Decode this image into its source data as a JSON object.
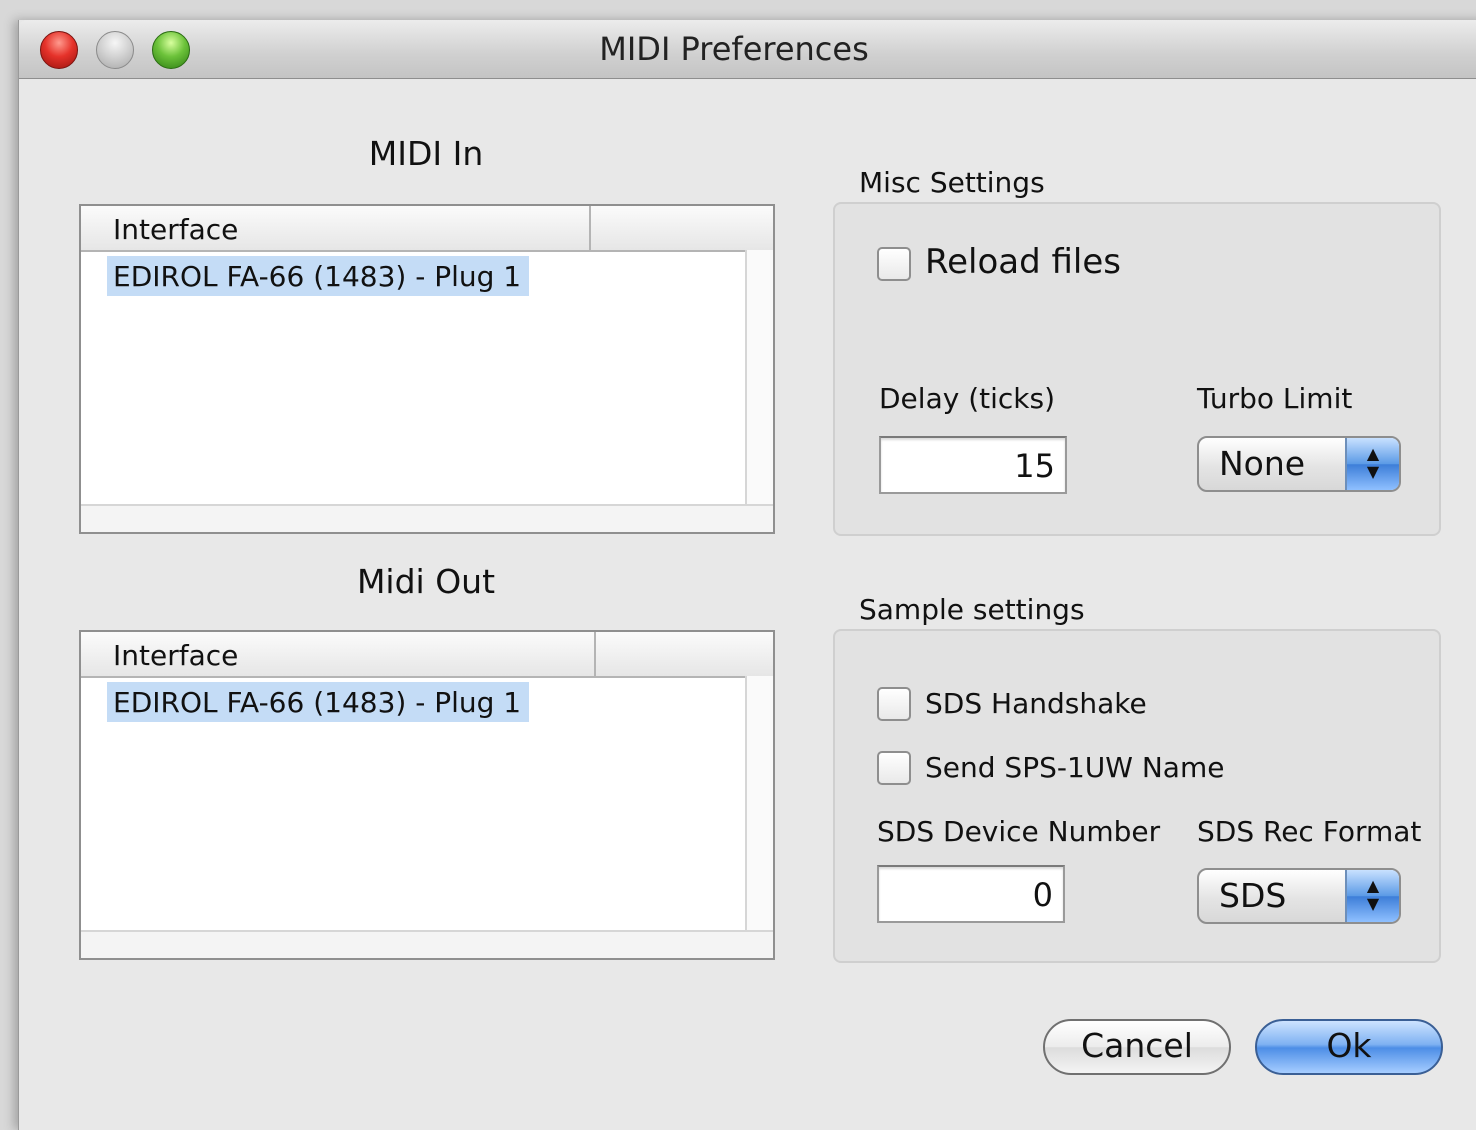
{
  "window": {
    "title": "MIDI Preferences"
  },
  "midi_in": {
    "heading": "MIDI In",
    "column_header": "Interface",
    "items": [
      "EDIROL FA-66 (1483) - Plug 1"
    ]
  },
  "midi_out": {
    "heading": "Midi Out",
    "column_header": "Interface",
    "items": [
      "EDIROL FA-66 (1483) - Plug 1"
    ]
  },
  "misc": {
    "label": "Misc Settings",
    "reload_files_label": "Reload files",
    "reload_files_checked": false,
    "delay_label": "Delay (ticks)",
    "delay_value": "15",
    "turbo_label": "Turbo Limit",
    "turbo_value": "None"
  },
  "sample": {
    "label": "Sample settings",
    "sds_handshake_label": "SDS Handshake",
    "sds_handshake_checked": false,
    "send_name_label": "Send SPS-1UW Name",
    "send_name_checked": false,
    "device_number_label": "SDS Device Number",
    "device_number_value": "0",
    "rec_format_label": "SDS Rec Format",
    "rec_format_value": "SDS"
  },
  "buttons": {
    "cancel": "Cancel",
    "ok": "Ok"
  },
  "colors": {
    "selection": "#c4dcf6",
    "accent_blue": "#5b9ae6"
  }
}
